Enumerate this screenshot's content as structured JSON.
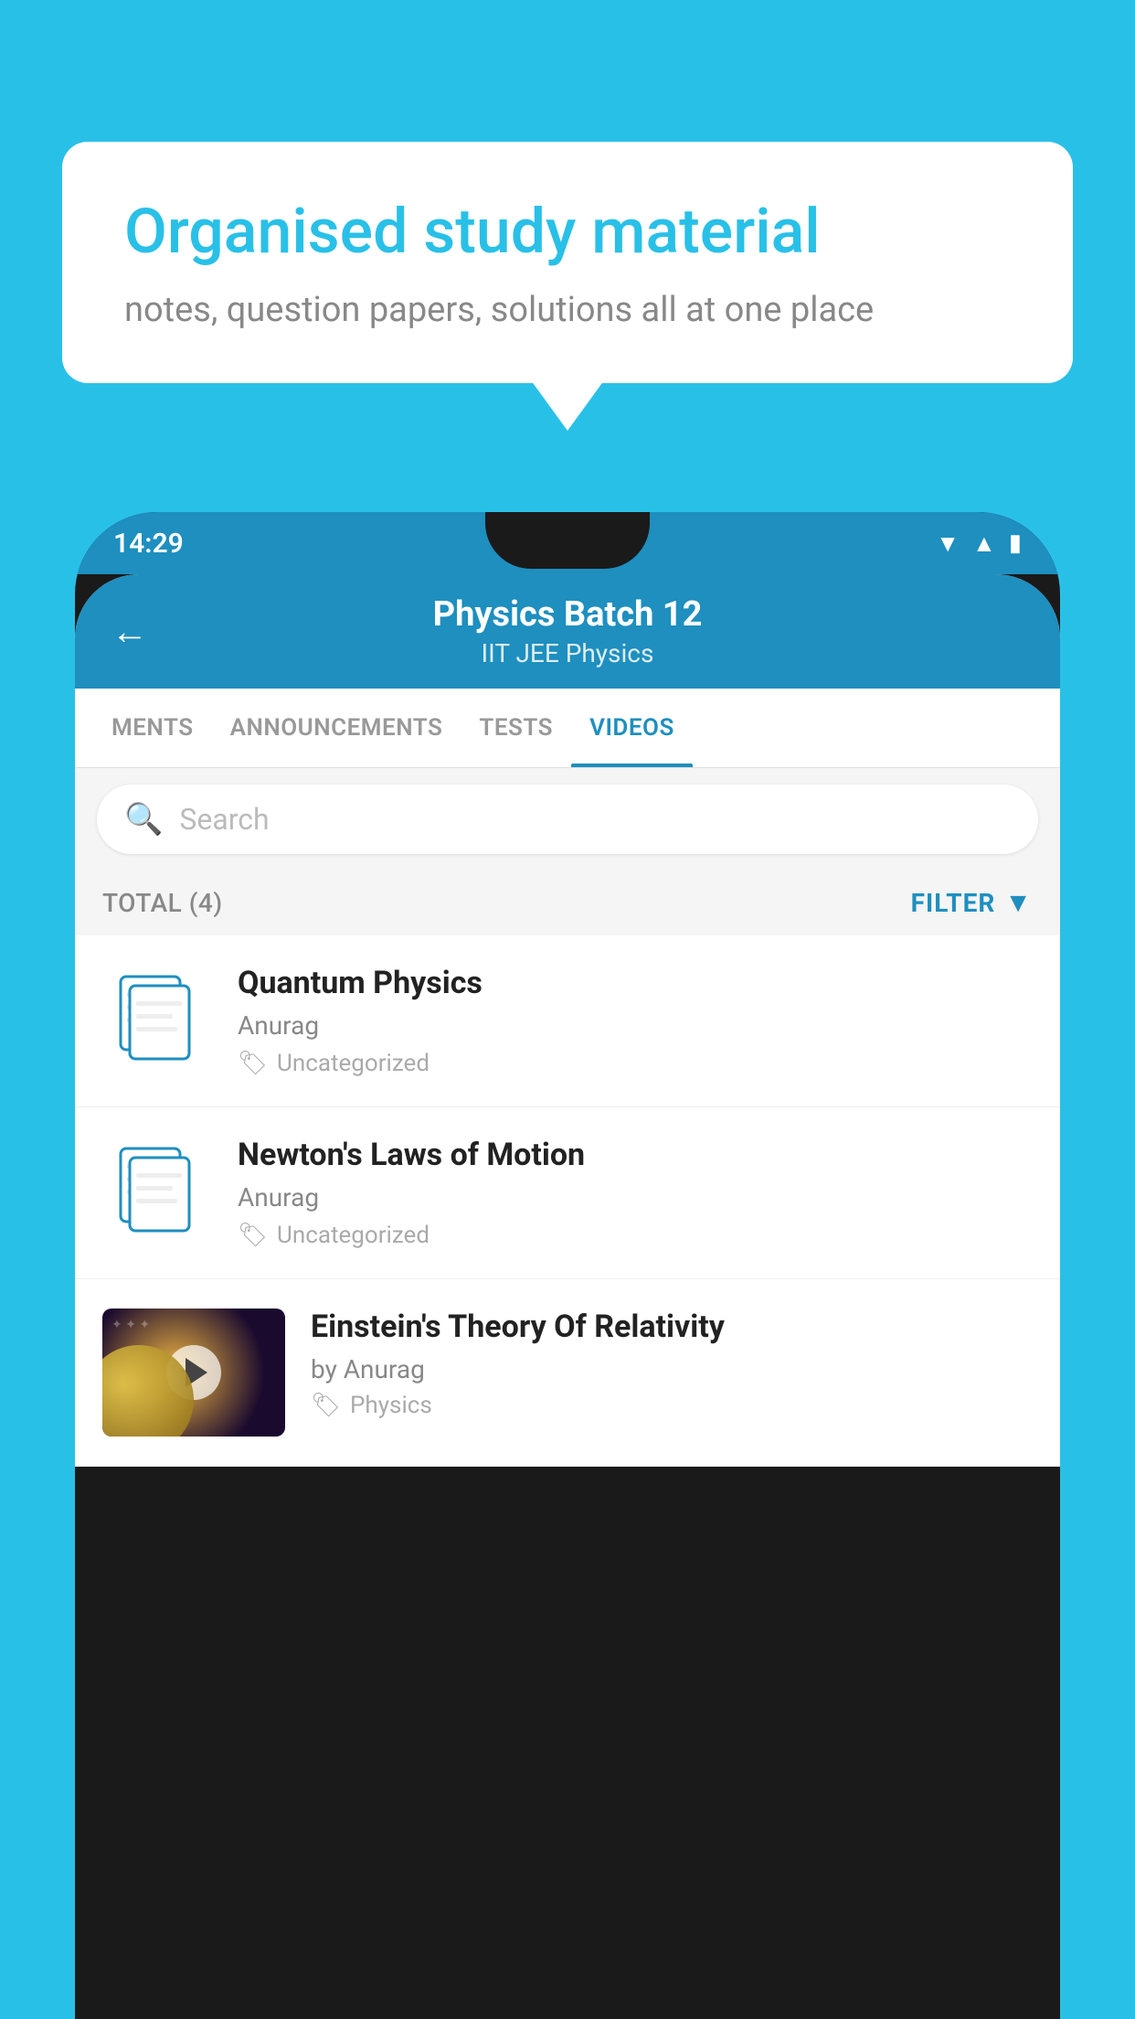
{
  "background": {
    "color": "#29C0E8"
  },
  "speech_bubble": {
    "title": "Organised study material",
    "subtitle": "notes, question papers, solutions all at one place"
  },
  "phone": {
    "status_bar": {
      "time": "14:29",
      "icons": [
        "wifi",
        "signal",
        "battery"
      ]
    },
    "header": {
      "back_label": "←",
      "title": "Physics Batch 12",
      "subtitle": "IIT JEE   Physics"
    },
    "tabs": [
      {
        "label": "MENTS",
        "active": false
      },
      {
        "label": "ANNOUNCEMENTS",
        "active": false
      },
      {
        "label": "TESTS",
        "active": false
      },
      {
        "label": "VIDEOS",
        "active": true
      }
    ],
    "search": {
      "placeholder": "Search"
    },
    "filter_bar": {
      "total": "TOTAL (4)",
      "filter_label": "FILTER"
    },
    "videos": [
      {
        "title": "Quantum Physics",
        "author": "Anurag",
        "tag": "Uncategorized",
        "has_thumbnail": false
      },
      {
        "title": "Newton's Laws of Motion",
        "author": "Anurag",
        "tag": "Uncategorized",
        "has_thumbnail": false
      },
      {
        "title": "Einstein's Theory Of Relativity",
        "author": "by Anurag",
        "tag": "Physics",
        "has_thumbnail": true
      }
    ]
  }
}
